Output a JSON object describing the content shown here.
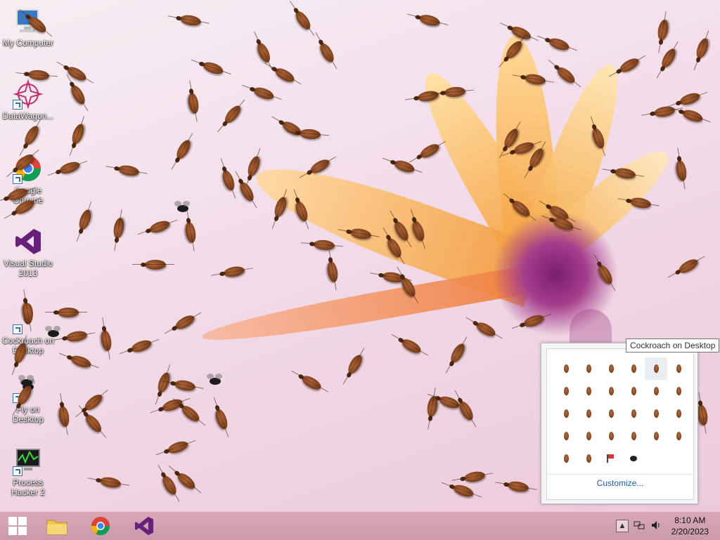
{
  "desktop": {
    "icons": [
      {
        "label": "My Computer",
        "icon": "computer-icon"
      },
      {
        "label": "DataWagon...",
        "icon": "datawagon-icon"
      },
      {
        "label": "Google Chrome",
        "icon": "chrome-icon"
      },
      {
        "label": "Visual Studio 2013",
        "icon": "visual-studio-icon"
      },
      {
        "label": "Cockroach on Desktop",
        "icon": "cockroach-icon"
      },
      {
        "label": "Fly on Desktop",
        "icon": "fly-icon"
      },
      {
        "label": "Process Hacker 2",
        "icon": "process-hacker-icon"
      }
    ]
  },
  "taskbar": {
    "pinned": [
      {
        "name": "start-button",
        "icon": "windows-icon"
      },
      {
        "name": "file-explorer",
        "icon": "folder-icon"
      },
      {
        "name": "chrome",
        "icon": "chrome-icon"
      },
      {
        "name": "visual-studio",
        "icon": "visual-studio-icon"
      }
    ],
    "tray": {
      "overflow_arrow": "▲",
      "time": "8:10 AM",
      "date": "2/20/2023"
    }
  },
  "tray_popup": {
    "customize_label": "Customize..."
  },
  "tooltip": {
    "text": "Cockroach on Desktop"
  },
  "colors": {
    "taskbar": "#c99aac",
    "accent_link": "#1e5aa8"
  }
}
